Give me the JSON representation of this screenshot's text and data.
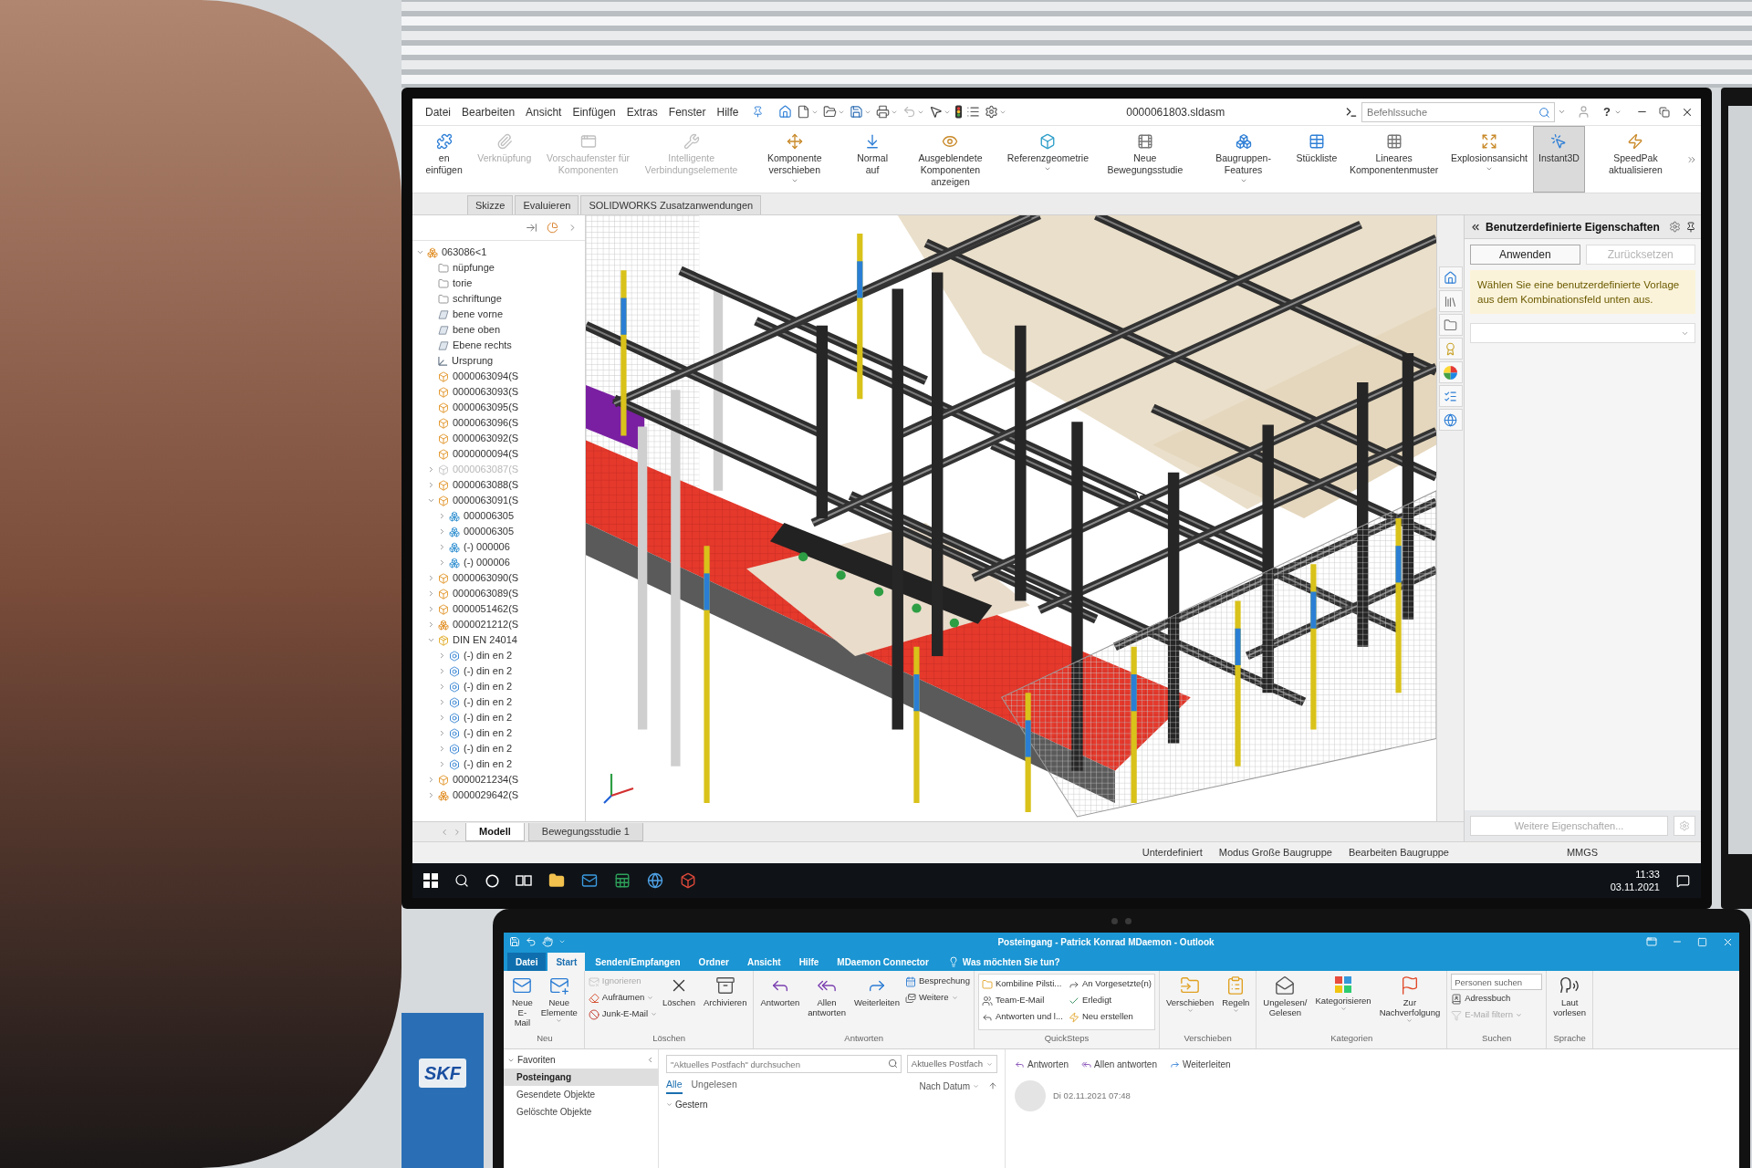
{
  "product_box": {
    "logo": "SKF"
  },
  "cad": {
    "menu": [
      "Datei",
      "Bearbeiten",
      "Ansicht",
      "Einfügen",
      "Extras",
      "Fenster",
      "Hilfe"
    ],
    "title": "0000061803.sldasm",
    "search": {
      "placeholder": "Befehlssuche"
    },
    "help": "?",
    "ribbon": [
      {
        "label": "en einfügen",
        "disabled": false,
        "selected": false,
        "dropdown": false
      },
      {
        "label": "Verknüpfung",
        "disabled": true,
        "selected": false,
        "dropdown": false
      },
      {
        "label": "Vorschaufenster für Komponenten",
        "disabled": true,
        "selected": false,
        "dropdown": false
      },
      {
        "label": "Intelligente Verbindungselemente",
        "disabled": true,
        "selected": false,
        "dropdown": false
      },
      {
        "label": "Komponente verschieben",
        "disabled": false,
        "selected": false,
        "dropdown": true
      },
      {
        "label": "Normal auf",
        "disabled": false,
        "selected": false,
        "dropdown": false
      },
      {
        "label": "Ausgeblendete Komponenten anzeigen",
        "disabled": false,
        "selected": false,
        "dropdown": false
      },
      {
        "label": "Referenzgeometrie",
        "disabled": false,
        "selected": false,
        "dropdown": true
      },
      {
        "label": "Neue Bewegungsstudie",
        "disabled": false,
        "selected": false,
        "dropdown": false
      },
      {
        "label": "Baugruppen-Features",
        "disabled": false,
        "selected": false,
        "dropdown": true
      },
      {
        "label": "Stückliste",
        "disabled": false,
        "selected": false,
        "dropdown": false
      },
      {
        "label": "Lineares Komponentenmuster",
        "disabled": false,
        "selected": false,
        "dropdown": false
      },
      {
        "label": "Explosionsansicht",
        "disabled": false,
        "selected": false,
        "dropdown": true
      },
      {
        "label": "Instant3D",
        "disabled": false,
        "selected": true,
        "dropdown": false
      },
      {
        "label": "SpeedPak aktualisieren",
        "disabled": false,
        "selected": false,
        "dropdown": false
      }
    ],
    "tabs": [
      {
        "label": "Skizze",
        "selected": false
      },
      {
        "label": "Evaluieren",
        "selected": false
      },
      {
        "label": "SOLIDWORKS Zusatzanwendungen",
        "selected": false
      }
    ],
    "tree": {
      "items": [
        {
          "label": "063086<1",
          "kind": "assembly",
          "disabled": false,
          "expanded": true,
          "children": [
            {
              "label": "nüpfunge",
              "kind": "folder",
              "disabled": false
            },
            {
              "label": "torie",
              "kind": "folder",
              "disabled": false
            },
            {
              "label": "schriftunge",
              "kind": "folder",
              "disabled": false
            },
            {
              "label": "bene vorne",
              "kind": "plane",
              "disabled": false
            },
            {
              "label": "bene oben",
              "kind": "plane",
              "disabled": false
            },
            {
              "label": "Ebene rechts",
              "kind": "plane",
              "disabled": false
            },
            {
              "label": "Ursprung",
              "kind": "origin",
              "disabled": false
            },
            {
              "label": "0000063094(S",
              "kind": "part",
              "disabled": false
            },
            {
              "label": "0000063093(S",
              "kind": "part",
              "disabled": false
            },
            {
              "label": "0000063095(S",
              "kind": "part",
              "disabled": false
            },
            {
              "label": "0000063096(S",
              "kind": "part",
              "disabled": false
            },
            {
              "label": "0000063092(S",
              "kind": "part",
              "disabled": false
            },
            {
              "label": "0000000094(S",
              "kind": "part",
              "disabled": false
            },
            {
              "label": "0000063087(S",
              "kind": "part",
              "disabled": true,
              "expanded": false
            },
            {
              "label": "0000063088(S",
              "kind": "part",
              "disabled": false,
              "expanded": false
            },
            {
              "label": "0000063091(S",
              "kind": "part",
              "disabled": false,
              "expanded": true,
              "children": [
                {
                  "label": "000006305",
                  "kind": "subassembly",
                  "disabled": false,
                  "expanded": false
                },
                {
                  "label": "000006305",
                  "kind": "subassembly",
                  "disabled": false,
                  "expanded": false
                },
                {
                  "label": "(-) 000006",
                  "kind": "subassembly",
                  "disabled": false,
                  "expanded": false
                },
                {
                  "label": "(-) 000006",
                  "kind": "subassembly",
                  "disabled": false,
                  "expanded": false
                }
              ]
            },
            {
              "label": "0000063090(S",
              "kind": "part",
              "disabled": false,
              "expanded": false
            },
            {
              "label": "0000063089(S",
              "kind": "part",
              "disabled": false,
              "expanded": false
            },
            {
              "label": "0000051462(S",
              "kind": "part",
              "disabled": false,
              "expanded": false
            },
            {
              "label": "0000021212(S",
              "kind": "assembly",
              "disabled": false,
              "expanded": false
            },
            {
              "label": "DIN EN 24014",
              "kind": "toolbox",
              "disabled": false,
              "expanded": true,
              "children": [
                {
                  "label": "(-) din en 2",
                  "kind": "fastener",
                  "disabled": false,
                  "expanded": false
                },
                {
                  "label": "(-) din en 2",
                  "kind": "fastener",
                  "disabled": false,
                  "expanded": false
                },
                {
                  "label": "(-) din en 2",
                  "kind": "fastener",
                  "disabled": false,
                  "expanded": false
                },
                {
                  "label": "(-) din en 2",
                  "kind": "fastener",
                  "disabled": false,
                  "expanded": false
                },
                {
                  "label": "(-) din en 2",
                  "kind": "fastener",
                  "disabled": false,
                  "expanded": false
                },
                {
                  "label": "(-) din en 2",
                  "kind": "fastener",
                  "disabled": false,
                  "expanded": false
                },
                {
                  "label": "(-) din en 2",
                  "kind": "fastener",
                  "disabled": false,
                  "expanded": false
                },
                {
                  "label": "(-) din en 2",
                  "kind": "fastener",
                  "disabled": false,
                  "expanded": false
                }
              ]
            },
            {
              "label": "0000021234(S",
              "kind": "part",
              "disabled": false,
              "expanded": false
            },
            {
              "label": "0000029642(S",
              "kind": "assembly",
              "disabled": false,
              "expanded": false
            }
          ]
        }
      ]
    },
    "model_tabs": [
      {
        "label": "Modell",
        "selected": true
      },
      {
        "label": "Bewegungsstudie 1",
        "selected": false
      }
    ],
    "panel": {
      "title": "Benutzerdefinierte Eigenschaften",
      "buttons": [
        {
          "label": "Anwenden",
          "disabled": false
        },
        {
          "label": "Zurücksetzen",
          "disabled": true
        }
      ],
      "message": "Wählen Sie eine benutzerdefinierte Vorlage aus dem Kombinationsfeld unten aus.",
      "more_button": {
        "label": "Weitere Eigenschaften...",
        "disabled": true
      }
    },
    "status_bar": [
      "Unterdefiniert",
      "Modus Große Baugruppe",
      "Bearbeiten Baugruppe",
      "MMGS"
    ]
  },
  "taskbar": {
    "time": "11:33",
    "date": "03.11.2021"
  },
  "outlook": {
    "title": "Posteingang - Patrick Konrad MDaemon - Outlook",
    "tabs": [
      {
        "label": "Datei",
        "kind": "file",
        "selected": false
      },
      {
        "label": "Start",
        "kind": "tab",
        "selected": true
      },
      {
        "label": "Senden/Empfangen",
        "kind": "tab",
        "selected": false
      },
      {
        "label": "Ordner",
        "kind": "tab",
        "selected": false
      },
      {
        "label": "Ansicht",
        "kind": "tab",
        "selected": false
      },
      {
        "label": "Hilfe",
        "kind": "tab",
        "selected": false
      },
      {
        "label": "MDaemon Connector",
        "kind": "tab",
        "selected": false
      }
    ],
    "tell_me": {
      "placeholder": "Was möchten Sie tun?"
    },
    "groups": [
      {
        "label": "Neu",
        "kind": "buttons",
        "items": [
          {
            "kind": "large",
            "label": "Neue E-Mail",
            "disabled": false,
            "dropdown": false
          },
          {
            "kind": "large",
            "label": "Neue Elemente",
            "disabled": false,
            "dropdown": true
          }
        ]
      },
      {
        "label": "Löschen",
        "kind": "buttons",
        "items": [
          {
            "kind": "small",
            "label": "Ignorieren",
            "disabled": true,
            "dropdown": false
          },
          {
            "kind": "small",
            "label": "Aufräumen",
            "disabled": false,
            "dropdown": true
          },
          {
            "kind": "small",
            "label": "Junk-E-Mail",
            "disabled": false,
            "dropdown": true
          },
          {
            "kind": "large",
            "label": "Löschen",
            "disabled": false,
            "dropdown": false
          },
          {
            "kind": "large",
            "label": "Archivieren",
            "disabled": false,
            "dropdown": false
          }
        ]
      },
      {
        "label": "Antworten",
        "kind": "buttons",
        "items": [
          {
            "kind": "large",
            "label": "Antworten",
            "disabled": false,
            "dropdown": false
          },
          {
            "kind": "large",
            "label": "Allen antworten",
            "disabled": false,
            "dropdown": false
          },
          {
            "kind": "large",
            "label": "Weiterleiten",
            "disabled": false,
            "dropdown": false
          },
          {
            "kind": "small",
            "label": "Besprechung",
            "disabled": false,
            "dropdown": false
          },
          {
            "kind": "small",
            "label": "Weitere",
            "disabled": false,
            "dropdown": true
          }
        ]
      },
      {
        "label": "QuickSteps",
        "kind": "gallery",
        "items": [
          {
            "kind": "small",
            "label": "Kombiline Pilsti...",
            "disabled": false,
            "dropdown": false
          },
          {
            "kind": "small",
            "label": "Team-E-Mail",
            "disabled": false,
            "dropdown": false
          },
          {
            "kind": "small",
            "label": "Antworten und l...",
            "disabled": false,
            "dropdown": false
          },
          {
            "kind": "small",
            "label": "An Vorgesetzte(n)",
            "disabled": false,
            "dropdown": false
          },
          {
            "kind": "small",
            "label": "Erledigt",
            "disabled": false,
            "dropdown": false
          },
          {
            "kind": "small",
            "label": "Neu erstellen",
            "disabled": false,
            "dropdown": false
          }
        ]
      },
      {
        "label": "Verschieben",
        "kind": "buttons",
        "items": [
          {
            "kind": "large",
            "label": "Verschieben",
            "disabled": false,
            "dropdown": true
          },
          {
            "kind": "large",
            "label": "Regeln",
            "disabled": false,
            "dropdown": true
          }
        ]
      },
      {
        "label": "Kategorien",
        "kind": "buttons",
        "items": [
          {
            "kind": "large",
            "label": "Ungelesen/ Gelesen",
            "disabled": false,
            "dropdown": false
          },
          {
            "kind": "large",
            "label": "Kategorisieren",
            "disabled": false,
            "dropdown": true
          },
          {
            "kind": "large",
            "label": "Zur Nachverfolgung",
            "disabled": false,
            "dropdown": true
          }
        ]
      },
      {
        "label": "Suchen",
        "kind": "buttons",
        "items": [
          {
            "kind": "field",
            "placeholder": "Personen suchen"
          },
          {
            "kind": "small",
            "label": "Adressbuch",
            "disabled": false,
            "dropdown": false
          },
          {
            "kind": "small",
            "label": "E-Mail filtern",
            "disabled": true,
            "dropdown": true
          }
        ]
      },
      {
        "label": "Sprache",
        "kind": "buttons",
        "items": [
          {
            "kind": "large",
            "label": "Laut vorlesen",
            "disabled": false,
            "dropdown": false
          }
        ]
      }
    ],
    "folders": {
      "header": "Favoriten",
      "expanded": true,
      "items": [
        {
          "label": "Posteingang",
          "selected": true
        },
        {
          "label": "Gesendete Objekte",
          "selected": false
        },
        {
          "label": "Gelöschte Objekte",
          "selected": false
        }
      ]
    },
    "list": {
      "search": {
        "placeholder": "\"Aktuelles Postfach\" durchsuchen"
      },
      "scope": "Aktuelles Postfach",
      "filters": [
        {
          "label": "Alle",
          "selected": true
        },
        {
          "label": "Ungelesen",
          "selected": false
        }
      ],
      "sort": "Nach Datum",
      "group": "Gestern"
    },
    "reading": {
      "actions": [
        "Antworten",
        "Allen antworten",
        "Weiterleiten"
      ],
      "date": "Di 02.11.2021 07:48"
    }
  }
}
